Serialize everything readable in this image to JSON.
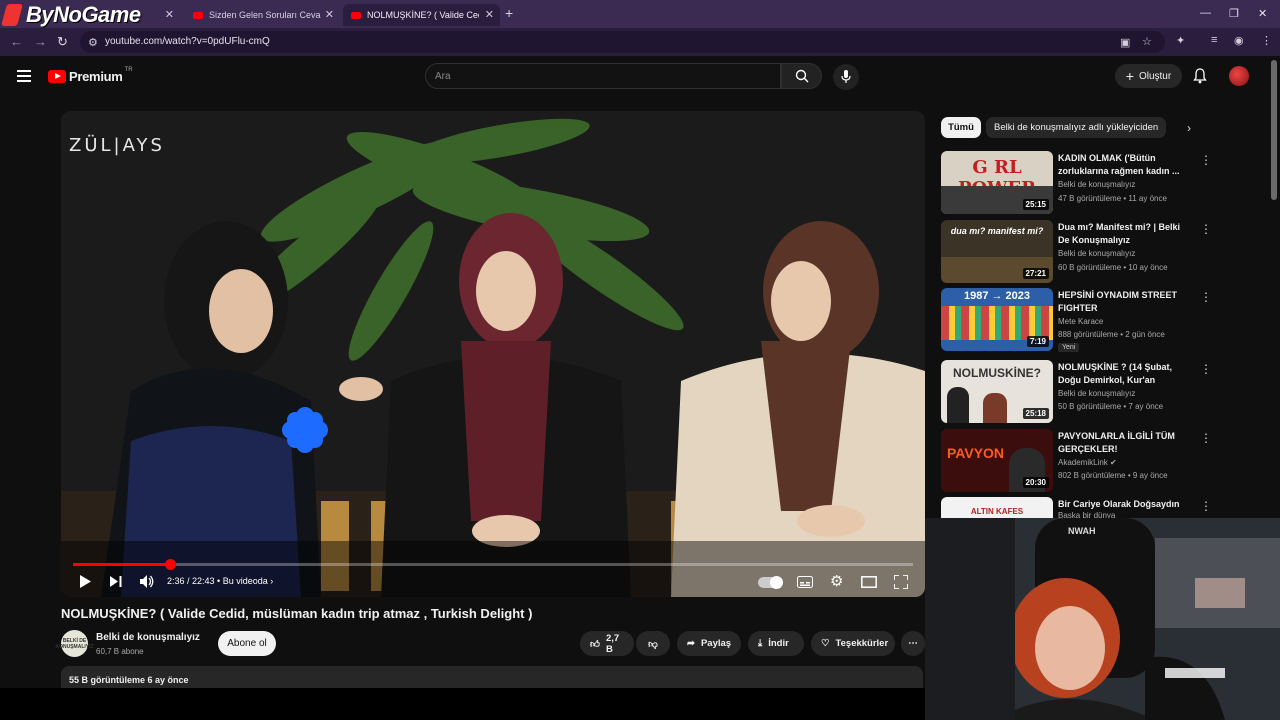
{
  "browser": {
    "brand": "ByNoGame",
    "tabs": [
      {
        "title": "Sizden Gelen Soruları Cevapladı"
      },
      {
        "title": "NOLMUŞKİNE? ( Valide Cedid, m"
      }
    ],
    "url": "youtube.com/watch?v=0pdUFlu-cmQ"
  },
  "header": {
    "logo": "Premium",
    "region": "TR",
    "search_placeholder": "Ara",
    "create_label": "Oluştur"
  },
  "player": {
    "watermark": "ZÜL|AYS",
    "time": "2:36 / 22:43",
    "chapter": "Bu videoda",
    "progress": 0.115
  },
  "video": {
    "title": "NOLMUŞKİNE? ( Valide Cedid, müslüman kadın trip atmaz , Turkish Delight )",
    "channel_name": "Belki de konuşmalıyız",
    "channel_avatar_text": "BELKİ DE KONUŞMALIYIZ",
    "subscribers": "60,7 B abone",
    "subscribe_label": "Abone ol",
    "likes": "2,7 B",
    "share_label": "Paylaş",
    "download_label": "İndir",
    "thanks_label": "Teşekkürler",
    "views_line": "55 B görüntüleme  6 ay önce"
  },
  "sidebar": {
    "chips": [
      "Tümü",
      "Belki de konuşmalıyız adlı yükleyiciden"
    ],
    "items": [
      {
        "title": "KADIN OLMAK ('Bütün zorluklarına rağmen kadın ...",
        "channel": "Belki de konuşmalıyız",
        "meta": "47 B görüntüleme • 11 ay önce",
        "duration": "25:15",
        "thumb_text": "G RL POWER",
        "thumb_bg": "#d9d2c4"
      },
      {
        "title": "Dua mı? Manifest mi? | Belki De Konuşmalıyız",
        "channel": "Belki de konuşmalıyız",
        "meta": "60 B görüntüleme • 10 ay önce",
        "duration": "27:21",
        "thumb_text": "dua mı? manifest mi?",
        "thumb_bg": "#3a3326"
      },
      {
        "title": "HEPSİNİ OYNADIM STREET FIGHTER",
        "channel": "Mete Karace",
        "meta": "888 görüntüleme • 2 gün önce",
        "duration": "7:19",
        "thumb_text": "1987 → 2023",
        "thumb_bg": "#2c5fa8",
        "badge": "Yeni"
      },
      {
        "title": "NOLMUŞKİNE ? (14 Şubat, Doğu Demirkol, Kur'an provokasyon...",
        "channel": "Belki de konuşmalıyız",
        "meta": "50 B görüntüleme • 7 ay önce",
        "duration": "25:18",
        "thumb_text": "NOLMUSKİNE?",
        "thumb_bg": "#e7e3dc"
      },
      {
        "title": "PAVYONLARLA İLGİLİ TÜM GERÇEKLER!",
        "channel": "AkademikLink",
        "meta": "802 B görüntüleme • 9 ay önce",
        "duration": "20:30",
        "thumb_text": "PAVYON",
        "thumb_bg": "#3b0d0d"
      },
      {
        "title": "Bir Cariye Olarak Doğsaydın",
        "channel": "Başka bir dünya",
        "meta": "",
        "duration": "",
        "thumb_text": "ALTIN KAFES",
        "thumb_bg": "#f2f2f2"
      }
    ]
  },
  "webcam": {
    "headphone_text": "NWAH"
  },
  "colors": {
    "accent": "#ff0000",
    "browser_frame": "#3b2a52",
    "background": "#0f0f0f"
  }
}
